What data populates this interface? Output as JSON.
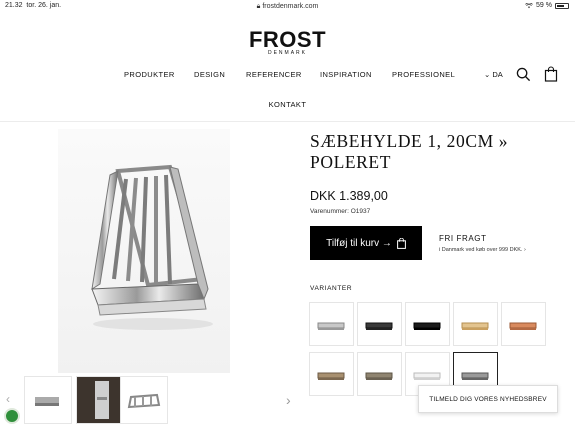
{
  "status_bar": {
    "time": "21.32",
    "date": "tor. 26. jan.",
    "url": "frostdenmark.com",
    "battery": "59 %"
  },
  "header": {
    "logo_main": "FROST",
    "logo_sub": "DENMARK",
    "nav": [
      "PRODUKTER",
      "DESIGN",
      "REFERENCER",
      "INSPIRATION",
      "PROFESSIONEL"
    ],
    "nav_second_row": "KONTAKT",
    "language": "DA",
    "icons": [
      "search-icon",
      "shopping-bag-icon"
    ]
  },
  "product": {
    "title": "SÆBEHYLDE 1, 20CM » POLERET",
    "price": "DKK 1.389,00",
    "sku": "Varenummer: O1937",
    "add_to_cart": "Tilføj til kurv →",
    "free_shipping_title": "FRI FRAGT",
    "free_shipping_text": "i Danmark ved køb over 999 DKK. ›",
    "variants_label": "VARIANTER",
    "variants": [
      {
        "finish": "polished steel"
      },
      {
        "finish": "black"
      },
      {
        "finish": "matte black"
      },
      {
        "finish": "gold"
      },
      {
        "finish": "copper"
      },
      {
        "finish": "brass"
      },
      {
        "finish": "bronze"
      },
      {
        "finish": "white"
      },
      {
        "finish": "polished",
        "selected": true
      }
    ],
    "thumbnails": [
      "product-front",
      "bathroom-scene",
      "product-detail"
    ]
  },
  "newsletter": "TILMELD DIG VORES NYHEDSBREV",
  "colors": {
    "button_bg": "#000000",
    "eco_badge": "#2f8f3b"
  }
}
